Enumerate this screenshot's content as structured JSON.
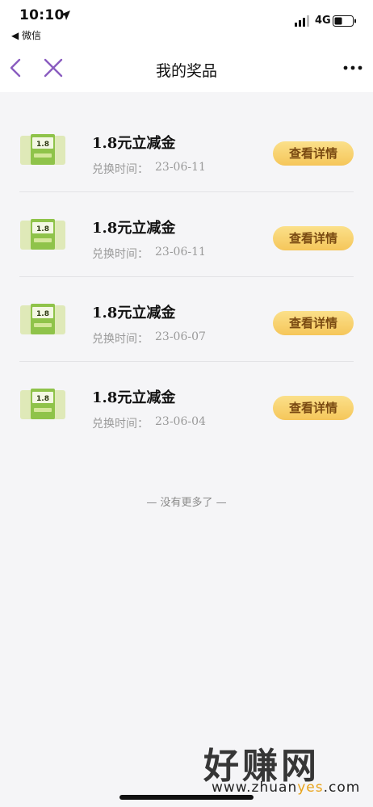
{
  "status_bar": {
    "time": "10:10",
    "back_app": "◀ 微信",
    "network": "4G"
  },
  "nav": {
    "title": "我的奖品",
    "more": "···"
  },
  "items": [
    {
      "thumb_value": "1.8",
      "title": "1.8元立减金",
      "date_label": "兑换时间：",
      "date": "23-06-11",
      "button": "查看详情"
    },
    {
      "thumb_value": "1.8",
      "title": "1.8元立减金",
      "date_label": "兑换时间：",
      "date": "23-06-11",
      "button": "查看详情"
    },
    {
      "thumb_value": "1.8",
      "title": "1.8元立减金",
      "date_label": "兑换时间：",
      "date": "23-06-07",
      "button": "查看详情"
    },
    {
      "thumb_value": "1.8",
      "title": "1.8元立减金",
      "date_label": "兑换时间：",
      "date": "23-06-04",
      "button": "查看详情"
    }
  ],
  "footer": {
    "no_more": "— 没有更多了 —"
  },
  "watermark": {
    "brand": "好赚网",
    "domain_prefix": "www.zhuan",
    "domain_accent": "yes",
    "domain_suffix": ".com"
  },
  "colors": {
    "accent_purple": "#8a5cc0",
    "button_gold": "#f5c65a",
    "button_text": "#7a4a12",
    "thumb_green": "#8fc34a"
  }
}
